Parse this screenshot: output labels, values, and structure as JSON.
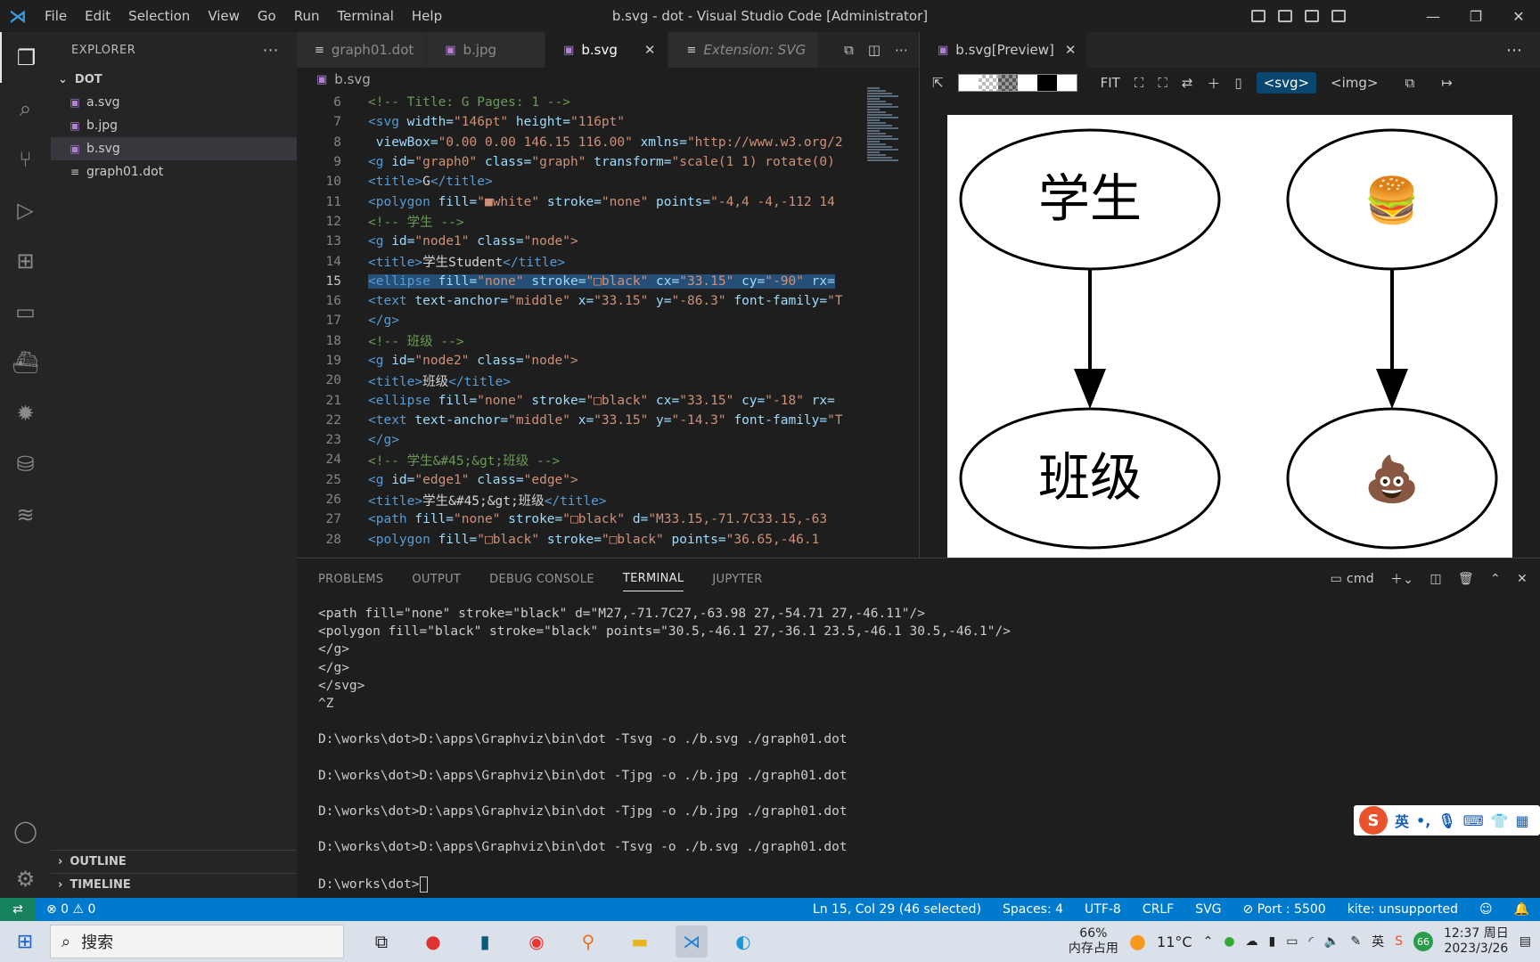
{
  "titlebar": {
    "menu": [
      "File",
      "Edit",
      "Selection",
      "View",
      "Go",
      "Run",
      "Terminal",
      "Help"
    ],
    "title": "b.svg - dot - Visual Studio Code [Administrator]"
  },
  "explorer": {
    "header": "EXPLORER",
    "folder": "DOT",
    "files": [
      "a.svg",
      "b.jpg",
      "b.svg",
      "graph01.dot"
    ],
    "outline": "OUTLINE",
    "timeline": "TIMELINE"
  },
  "editor": {
    "tabs": [
      "graph01.dot",
      "b.jpg",
      "b.svg",
      "Extension: SVG"
    ],
    "breadcrumb": "b.svg",
    "lines": [
      {
        "n": "6",
        "segs": [
          [
            "cmt",
            "<!-- Title: G Pages: 1 -->"
          ]
        ]
      },
      {
        "n": "7",
        "segs": [
          [
            "tag",
            "<svg "
          ],
          [
            "attr",
            "width="
          ],
          [
            "str",
            "\"146pt\" "
          ],
          [
            "attr",
            "height="
          ],
          [
            "str",
            "\"116pt\""
          ]
        ]
      },
      {
        "n": "8",
        "segs": [
          [
            "attr",
            " viewBox="
          ],
          [
            "str",
            "\"0.00 0.00 146.15 116.00\" "
          ],
          [
            "attr",
            "xmlns="
          ],
          [
            "str",
            "\"http://www.w3.org/2"
          ]
        ]
      },
      {
        "n": "9",
        "segs": [
          [
            "tag",
            "<g "
          ],
          [
            "attr",
            "id="
          ],
          [
            "str",
            "\"graph0\" "
          ],
          [
            "attr",
            "class="
          ],
          [
            "str",
            "\"graph\" "
          ],
          [
            "attr",
            "transform="
          ],
          [
            "str",
            "\"scale(1 1) rotate(0)"
          ]
        ]
      },
      {
        "n": "10",
        "segs": [
          [
            "tag",
            "<title>"
          ],
          [
            "plain",
            "G"
          ],
          [
            "tag",
            "</title>"
          ]
        ]
      },
      {
        "n": "11",
        "segs": [
          [
            "tag",
            "<polygon "
          ],
          [
            "attr",
            "fill="
          ],
          [
            "str",
            "\"■white\" "
          ],
          [
            "attr",
            "stroke="
          ],
          [
            "str",
            "\"none\" "
          ],
          [
            "attr",
            "points="
          ],
          [
            "str",
            "\"-4,4 -4,-112 14"
          ]
        ]
      },
      {
        "n": "12",
        "segs": [
          [
            "cmt",
            "<!-- 学生 -->"
          ]
        ]
      },
      {
        "n": "13",
        "segs": [
          [
            "tag",
            "<g "
          ],
          [
            "attr",
            "id="
          ],
          [
            "str",
            "\"node1\" "
          ],
          [
            "attr",
            "class="
          ],
          [
            "str",
            "\"node\">"
          ]
        ]
      },
      {
        "n": "14",
        "segs": [
          [
            "tag",
            "<title>"
          ],
          [
            "plain",
            "学生Student"
          ],
          [
            "tag",
            "</title>"
          ]
        ]
      },
      {
        "n": "15",
        "segs": [
          [
            "tag",
            "<ellipse "
          ],
          [
            "attr",
            "fill="
          ],
          [
            "str",
            "\"none\" "
          ],
          [
            "attr",
            "stroke="
          ],
          [
            "str",
            "\"□black\" "
          ],
          [
            "attr",
            "cx="
          ],
          [
            "str",
            "\"33.15\" "
          ],
          [
            "attr",
            "cy="
          ],
          [
            "str",
            "\"-90\" "
          ],
          [
            "attr",
            "rx="
          ]
        ],
        "cur": true
      },
      {
        "n": "16",
        "segs": [
          [
            "tag",
            "<text "
          ],
          [
            "attr",
            "text-anchor="
          ],
          [
            "str",
            "\"middle\" "
          ],
          [
            "attr",
            "x="
          ],
          [
            "str",
            "\"33.15\" "
          ],
          [
            "attr",
            "y="
          ],
          [
            "str",
            "\"-86.3\" "
          ],
          [
            "attr",
            "font-family="
          ],
          [
            "str",
            "\"T"
          ]
        ]
      },
      {
        "n": "17",
        "segs": [
          [
            "tag",
            "</g>"
          ]
        ]
      },
      {
        "n": "18",
        "segs": [
          [
            "cmt",
            "<!-- 班级 -->"
          ]
        ]
      },
      {
        "n": "19",
        "segs": [
          [
            "tag",
            "<g "
          ],
          [
            "attr",
            "id="
          ],
          [
            "str",
            "\"node2\" "
          ],
          [
            "attr",
            "class="
          ],
          [
            "str",
            "\"node\">"
          ]
        ]
      },
      {
        "n": "20",
        "segs": [
          [
            "tag",
            "<title>"
          ],
          [
            "plain",
            "班级"
          ],
          [
            "tag",
            "</title>"
          ]
        ]
      },
      {
        "n": "21",
        "segs": [
          [
            "tag",
            "<ellipse "
          ],
          [
            "attr",
            "fill="
          ],
          [
            "str",
            "\"none\" "
          ],
          [
            "attr",
            "stroke="
          ],
          [
            "str",
            "\"□black\" "
          ],
          [
            "attr",
            "cx="
          ],
          [
            "str",
            "\"33.15\" "
          ],
          [
            "attr",
            "cy="
          ],
          [
            "str",
            "\"-18\" "
          ],
          [
            "attr",
            "rx="
          ]
        ]
      },
      {
        "n": "22",
        "segs": [
          [
            "tag",
            "<text "
          ],
          [
            "attr",
            "text-anchor="
          ],
          [
            "str",
            "\"middle\" "
          ],
          [
            "attr",
            "x="
          ],
          [
            "str",
            "\"33.15\" "
          ],
          [
            "attr",
            "y="
          ],
          [
            "str",
            "\"-14.3\" "
          ],
          [
            "attr",
            "font-family="
          ],
          [
            "str",
            "\"T"
          ]
        ]
      },
      {
        "n": "23",
        "segs": [
          [
            "tag",
            "</g>"
          ]
        ]
      },
      {
        "n": "24",
        "segs": [
          [
            "cmt",
            "<!-- 学生&#45;&gt;班级 -->"
          ]
        ]
      },
      {
        "n": "25",
        "segs": [
          [
            "tag",
            "<g "
          ],
          [
            "attr",
            "id="
          ],
          [
            "str",
            "\"edge1\" "
          ],
          [
            "attr",
            "class="
          ],
          [
            "str",
            "\"edge\">"
          ]
        ]
      },
      {
        "n": "26",
        "segs": [
          [
            "tag",
            "<title>"
          ],
          [
            "plain",
            "学生&#45;&gt;班级"
          ],
          [
            "tag",
            "</title>"
          ]
        ]
      },
      {
        "n": "27",
        "segs": [
          [
            "tag",
            "<path "
          ],
          [
            "attr",
            "fill="
          ],
          [
            "str",
            "\"none\" "
          ],
          [
            "attr",
            "stroke="
          ],
          [
            "str",
            "\"□black\" "
          ],
          [
            "attr",
            "d="
          ],
          [
            "str",
            "\"M33.15,-71.7C33.15,-63"
          ]
        ]
      },
      {
        "n": "28",
        "segs": [
          [
            "tag",
            "<polygon "
          ],
          [
            "attr",
            "fill="
          ],
          [
            "str",
            "\"□black\" "
          ],
          [
            "attr",
            "stroke="
          ],
          [
            "str",
            "\"□black\" "
          ],
          [
            "attr",
            "points="
          ],
          [
            "str",
            "\"36.65,-46.1"
          ]
        ]
      }
    ]
  },
  "preview": {
    "tab": "b.svg[Preview]",
    "fit": "FIT",
    "svg_btn": "<svg>",
    "img_btn": "<img>",
    "nodes": {
      "n1": "学生",
      "n2": "班级",
      "n3": "🍔",
      "n4": "💩"
    }
  },
  "panel": {
    "tabs": [
      "PROBLEMS",
      "OUTPUT",
      "DEBUG CONSOLE",
      "TERMINAL",
      "JUPYTER"
    ],
    "shell": "cmd",
    "terminal_lines": [
      "<path fill=\"none\" stroke=\"black\" d=\"M27,-71.7C27,-63.98 27,-54.71 27,-46.11\"/>",
      "<polygon fill=\"black\" stroke=\"black\" points=\"30.5,-46.1 27,-36.1 23.5,-46.1 30.5,-46.1\"/>",
      "</g>",
      "</g>",
      "</svg>",
      "^Z",
      "",
      "D:\\works\\dot>D:\\apps\\Graphviz\\bin\\dot -Tsvg -o ./b.svg ./graph01.dot",
      "",
      "D:\\works\\dot>D:\\apps\\Graphviz\\bin\\dot -Tjpg -o ./b.jpg ./graph01.dot",
      "",
      "D:\\works\\dot>D:\\apps\\Graphviz\\bin\\dot -Tjpg -o ./b.jpg ./graph01.dot",
      "",
      "D:\\works\\dot>D:\\apps\\Graphviz\\bin\\dot -Tsvg -o ./b.svg ./graph01.dot",
      ""
    ],
    "prompt": "D:\\works\\dot>"
  },
  "status": {
    "problems": "⊗ 0 ⚠ 0",
    "position": "Ln 15, Col 29 (46 selected)",
    "spaces": "Spaces: 4",
    "encoding": "UTF-8",
    "eol": "CRLF",
    "language": "SVG",
    "port": "⊘ Port : 5500",
    "kite": "kite: unsupported"
  },
  "ime": {
    "lang": "英"
  },
  "taskbar": {
    "search": "搜索",
    "mem_pct": "66%",
    "mem_label": "内存占用",
    "temp": "11°C",
    "ime": "英",
    "badge": "66",
    "time": "12:37 周日",
    "date": "2023/3/26"
  }
}
